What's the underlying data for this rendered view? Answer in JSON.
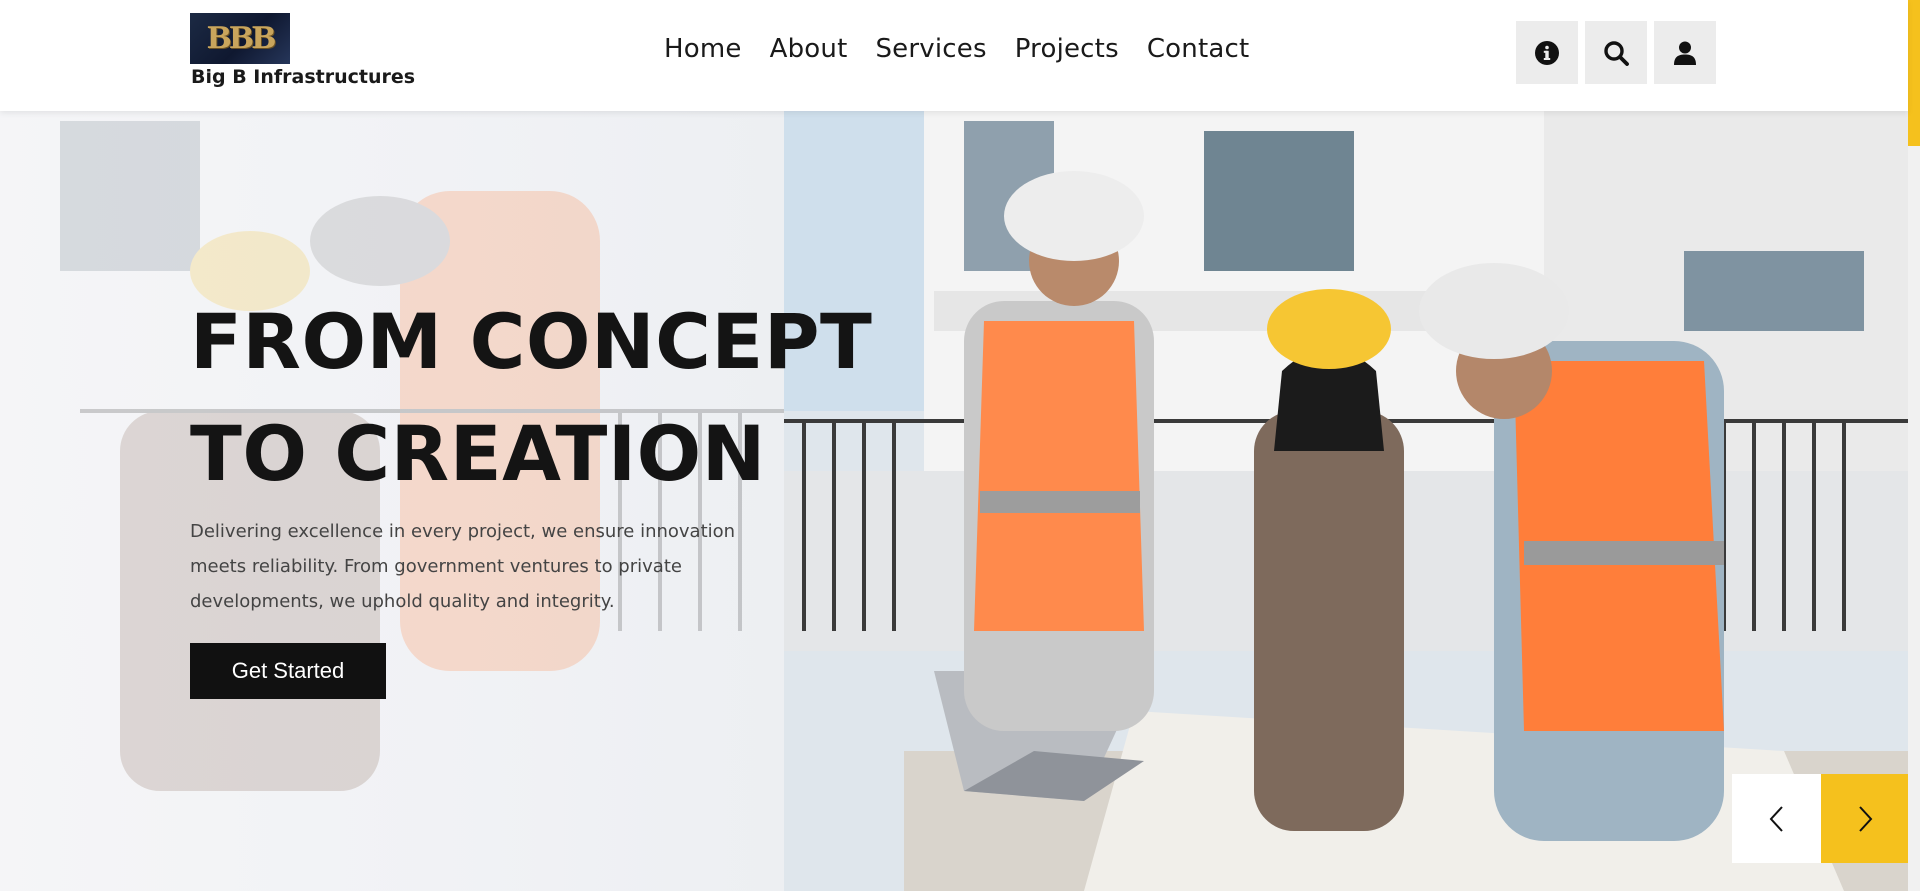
{
  "header": {
    "logo": {
      "mark": "BBB"
    },
    "brand_name": "Big B Infrastructures",
    "nav": [
      {
        "label": "Home"
      },
      {
        "label": "About"
      },
      {
        "label": "Services"
      },
      {
        "label": "Projects"
      },
      {
        "label": "Contact"
      }
    ],
    "actions": [
      {
        "icon": "info-icon"
      },
      {
        "icon": "search-icon"
      },
      {
        "icon": "user-icon"
      }
    ]
  },
  "hero": {
    "title_line1": "FROM CONCEPT",
    "title_line2": "TO CREATION",
    "description": "Delivering excellence in every project, we ensure innovation meets reliability. From government ventures to private developments, we uphold quality and integrity.",
    "cta_label": "Get Started",
    "image": "construction workers in safety vests and helmets reviewing blueprints with a laptop in front of a house",
    "slider": {
      "prev_icon": "chevron-left-icon",
      "next_icon": "chevron-right-icon"
    }
  },
  "colors": {
    "accent": "#f5c11d",
    "button_dark": "#111111",
    "icon_button_bg": "#ececec"
  }
}
